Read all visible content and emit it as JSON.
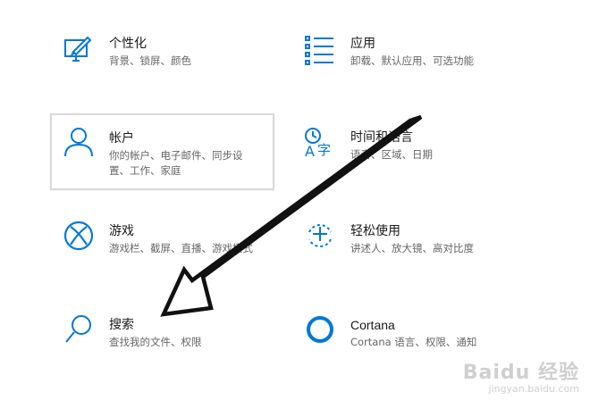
{
  "settings": {
    "personalization": {
      "title": "个性化",
      "desc": "背景、锁屏、颜色",
      "icon": "personalization-icon"
    },
    "apps": {
      "title": "应用",
      "desc": "卸载、默认应用、可选功能",
      "icon": "apps-list-icon"
    },
    "accounts": {
      "title": "帐户",
      "desc_line1": "你的帐户、电子邮件、同步设",
      "desc_line2": "置、工作、家庭",
      "icon": "person-icon"
    },
    "time_language": {
      "title": "时间和语言",
      "desc": "语音、区域、日期",
      "icon": "time-language-icon"
    },
    "gaming": {
      "title": "游戏",
      "desc": "游戏栏、截屏、直播、游戏模式",
      "icon": "xbox-icon"
    },
    "ease_of_access": {
      "title": "轻松使用",
      "desc": "讲述人、放大镜、高对比度",
      "icon": "ease-of-access-icon"
    },
    "search": {
      "title": "搜索",
      "desc": "查找我的文件、权限",
      "icon": "search-icon"
    },
    "cortana": {
      "title": "Cortana",
      "desc": "Cortana 语言、权限、通知",
      "icon": "cortana-icon"
    }
  },
  "watermark": {
    "main": "Baidu 经验",
    "sub": "jingyan.baidu.com"
  },
  "colors": {
    "accent": "#0078d7",
    "arrow": "#111111"
  }
}
